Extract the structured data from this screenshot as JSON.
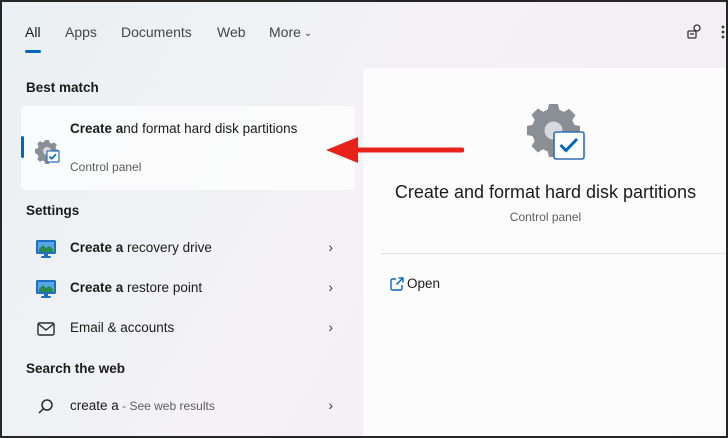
{
  "tabs": [
    {
      "label": "All"
    },
    {
      "label": "Apps"
    },
    {
      "label": "Documents"
    },
    {
      "label": "Web"
    },
    {
      "label": "More"
    }
  ],
  "best_match": {
    "heading": "Best match",
    "title_bold": "Create a",
    "title_rest": "nd format hard disk partitions",
    "subtitle": "Control panel"
  },
  "settings": {
    "heading": "Settings",
    "items": [
      {
        "bold": "Create a",
        "rest": " recovery drive",
        "icon": "monitor-icon"
      },
      {
        "bold": "Create a",
        "rest": " restore point",
        "icon": "monitor-icon"
      },
      {
        "bold": "",
        "rest": "Email & accounts",
        "icon": "mail-icon"
      }
    ]
  },
  "web": {
    "heading": "Search the web",
    "query": "create a",
    "suffix": " - See web results"
  },
  "detail": {
    "title": "Create and format hard disk partitions",
    "subtitle": "Control panel",
    "open_label": "Open"
  },
  "colors": {
    "accent": "#0067c0",
    "annotation": "#e8221b"
  }
}
